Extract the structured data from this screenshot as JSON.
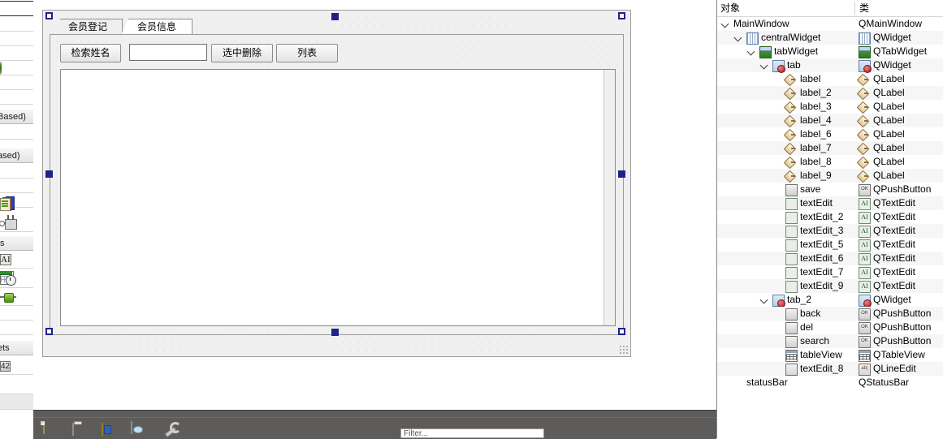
{
  "widget_box": {
    "search_placeholder": "",
    "categories": [
      "Based)",
      "ased)",
      "ts",
      "ets"
    ],
    "icons": [
      "arrow-right-icon",
      "stacked-books-icon",
      "container-icon",
      "label-ai-icon",
      "datetime-icon",
      "slider-icon",
      "spinbox-42-icon",
      "qt-logo-icon"
    ]
  },
  "form": {
    "tabs": [
      {
        "label": "会员登记",
        "selected": false
      },
      {
        "label": "会员信息",
        "selected": true
      }
    ],
    "buttons": [
      {
        "name": "search",
        "label": "检索姓名"
      },
      {
        "name": "del",
        "label": "选中删除"
      },
      {
        "name": "back",
        "label": "列表"
      }
    ],
    "line_edit": {
      "name": "textEdit_8",
      "value": "",
      "placeholder": ""
    },
    "table_view": {
      "name": "tableView"
    }
  },
  "bottom_toolbar": {
    "icons": [
      "new-file-icon",
      "open-file-icon",
      "open-project-icon",
      "recent-file-icon",
      "wrench-icon"
    ],
    "filter_text": "Filter..."
  },
  "inspector": {
    "columns": [
      "对象",
      "类"
    ],
    "rows": [
      {
        "indent": 0,
        "expander": true,
        "object": "MainWindow",
        "class": "QMainWindow",
        "icon": ""
      },
      {
        "indent": 1,
        "expander": true,
        "object": "centralWidget",
        "class": "QWidget",
        "icon": "central-widget-icon"
      },
      {
        "indent": 2,
        "expander": true,
        "object": "tabWidget",
        "class": "QTabWidget",
        "icon": "tab-widget-icon"
      },
      {
        "indent": 3,
        "expander": true,
        "object": "tab",
        "class": "QWidget",
        "icon": "tab-page-icon"
      },
      {
        "indent": 4,
        "expander": false,
        "object": "label",
        "class": "QLabel",
        "icon": "label-icon"
      },
      {
        "indent": 4,
        "expander": false,
        "object": "label_2",
        "class": "QLabel",
        "icon": "label-icon"
      },
      {
        "indent": 4,
        "expander": false,
        "object": "label_3",
        "class": "QLabel",
        "icon": "label-icon"
      },
      {
        "indent": 4,
        "expander": false,
        "object": "label_4",
        "class": "QLabel",
        "icon": "label-icon"
      },
      {
        "indent": 4,
        "expander": false,
        "object": "label_6",
        "class": "QLabel",
        "icon": "label-icon"
      },
      {
        "indent": 4,
        "expander": false,
        "object": "label_7",
        "class": "QLabel",
        "icon": "label-icon"
      },
      {
        "indent": 4,
        "expander": false,
        "object": "label_8",
        "class": "QLabel",
        "icon": "label-icon"
      },
      {
        "indent": 4,
        "expander": false,
        "object": "label_9",
        "class": "QLabel",
        "icon": "label-icon"
      },
      {
        "indent": 4,
        "expander": false,
        "object": "save",
        "class": "QPushButton",
        "icon": "pushbutton-icon"
      },
      {
        "indent": 4,
        "expander": false,
        "object": "textEdit",
        "class": "QTextEdit",
        "icon": "textedit-icon"
      },
      {
        "indent": 4,
        "expander": false,
        "object": "textEdit_2",
        "class": "QTextEdit",
        "icon": "textedit-icon"
      },
      {
        "indent": 4,
        "expander": false,
        "object": "textEdit_3",
        "class": "QTextEdit",
        "icon": "textedit-icon"
      },
      {
        "indent": 4,
        "expander": false,
        "object": "textEdit_5",
        "class": "QTextEdit",
        "icon": "textedit-icon"
      },
      {
        "indent": 4,
        "expander": false,
        "object": "textEdit_6",
        "class": "QTextEdit",
        "icon": "textedit-icon"
      },
      {
        "indent": 4,
        "expander": false,
        "object": "textEdit_7",
        "class": "QTextEdit",
        "icon": "textedit-icon"
      },
      {
        "indent": 4,
        "expander": false,
        "object": "textEdit_9",
        "class": "QTextEdit",
        "icon": "textedit-icon"
      },
      {
        "indent": 3,
        "expander": true,
        "object": "tab_2",
        "class": "QWidget",
        "icon": "tab-page-icon"
      },
      {
        "indent": 4,
        "expander": false,
        "object": "back",
        "class": "QPushButton",
        "icon": "pushbutton-icon"
      },
      {
        "indent": 4,
        "expander": false,
        "object": "del",
        "class": "QPushButton",
        "icon": "pushbutton-icon"
      },
      {
        "indent": 4,
        "expander": false,
        "object": "search",
        "class": "QPushButton",
        "icon": "pushbutton-icon"
      },
      {
        "indent": 4,
        "expander": false,
        "object": "tableView",
        "class": "QTableView",
        "icon": "tableview-icon"
      },
      {
        "indent": 4,
        "expander": false,
        "object": "textEdit_8",
        "class": "QLineEdit",
        "icon": "lineedit-icon"
      },
      {
        "indent": 1,
        "expander": false,
        "object": "statusBar",
        "class": "QStatusBar",
        "icon": ""
      }
    ]
  },
  "colors": {
    "selection_handle": "#20208c",
    "form_bg": "#f0f0f0",
    "toolbar_bg": "#5e5c5a",
    "row_alt": "#f6f6f6"
  }
}
